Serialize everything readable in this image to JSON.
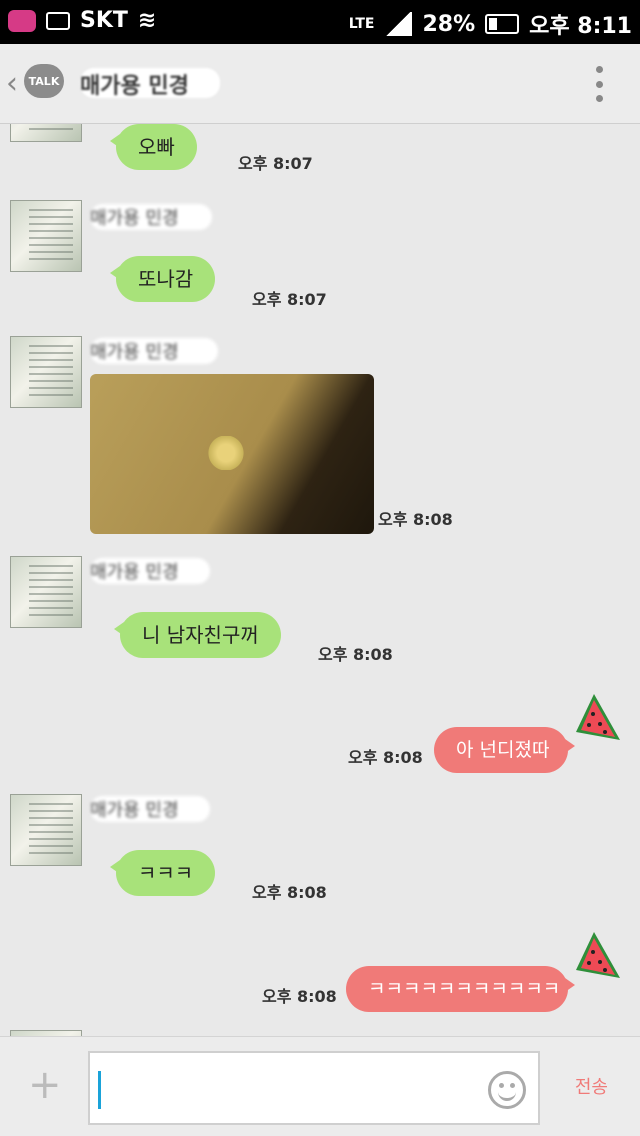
{
  "status_bar": {
    "carrier": "SKT",
    "network": "LTE",
    "battery": "28%",
    "time": "오후 8:11"
  },
  "header": {
    "logo": "TALK",
    "title": "매가용 민경"
  },
  "messages": [
    {
      "type": "in",
      "name": "",
      "text": "오빠",
      "time": "오후 8:07"
    },
    {
      "type": "in",
      "name": "매가용 민경",
      "text": "또나감",
      "time": "오후 8:07"
    },
    {
      "type": "in",
      "name": "매가용 민경",
      "image": "photo",
      "time": "오후 8:08"
    },
    {
      "type": "in",
      "name": "매가용 민경",
      "text": "니 남자친구꺼",
      "time": "오후 8:08"
    },
    {
      "type": "out",
      "text": "아 넌디졌따",
      "time": "오후 8:08"
    },
    {
      "type": "in",
      "name": "매가용 민경",
      "text": "ㅋㅋㅋ",
      "time": "오후 8:08"
    },
    {
      "type": "out",
      "text": "ㅋㅋㅋㅋㅋㅋㅋㅋㅋㅋㅋ",
      "time": "오후 8:08"
    }
  ],
  "input": {
    "placeholder": "",
    "send_label": "전송"
  },
  "colors": {
    "incoming_bubble": "#a8e27a",
    "outgoing_bubble": "#f07a78",
    "background": "#e9e9e9"
  }
}
